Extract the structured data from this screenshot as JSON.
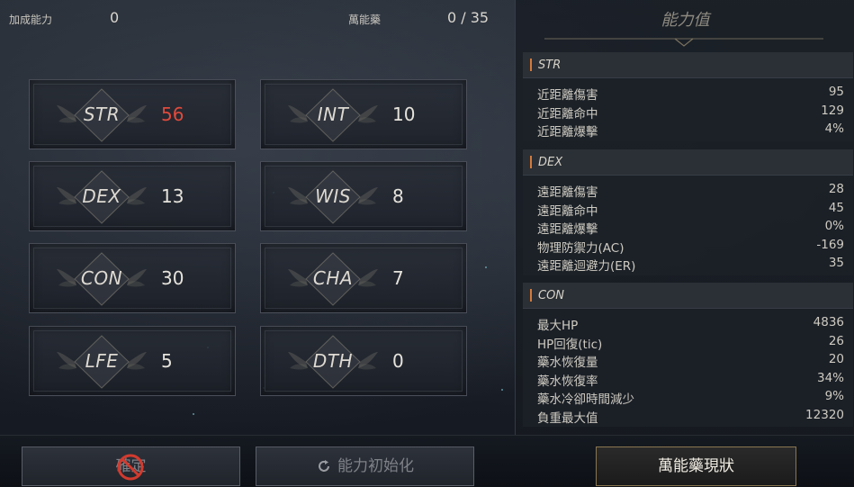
{
  "top": {
    "bonus_label": "加成能力",
    "bonus_value": "0",
    "elixir_label": "萬能藥",
    "elixir_value": "0 / 35"
  },
  "stats": [
    {
      "name": "STR",
      "value": "56",
      "highlight": true
    },
    {
      "name": "INT",
      "value": "10",
      "highlight": false
    },
    {
      "name": "DEX",
      "value": "13",
      "highlight": false
    },
    {
      "name": "WIS",
      "value": "8",
      "highlight": false
    },
    {
      "name": "CON",
      "value": "30",
      "highlight": false
    },
    {
      "name": "CHA",
      "value": "7",
      "highlight": false
    },
    {
      "name": "LFE",
      "value": "5",
      "highlight": false
    },
    {
      "name": "DTH",
      "value": "0",
      "highlight": false
    }
  ],
  "buttons": {
    "confirm_label": "確定",
    "reset_label": "能力初始化",
    "elixir_status_label": "萬能藥現狀"
  },
  "right_panel": {
    "title": "能力值",
    "sections": [
      {
        "header": "STR",
        "rows": [
          {
            "label": "近距離傷害",
            "value": "95"
          },
          {
            "label": "近距離命中",
            "value": "129"
          },
          {
            "label": "近距離爆擊",
            "value": "4%"
          }
        ]
      },
      {
        "header": "DEX",
        "rows": [
          {
            "label": "遠距離傷害",
            "value": "28"
          },
          {
            "label": "遠距離命中",
            "value": "45"
          },
          {
            "label": "遠距離爆擊",
            "value": "0%"
          },
          {
            "label": "物理防禦力(AC)",
            "value": "-169"
          },
          {
            "label": "遠距離迴避力(ER)",
            "value": "35"
          }
        ]
      },
      {
        "header": "CON",
        "rows": [
          {
            "label": "最大HP",
            "value": "4836"
          },
          {
            "label": "HP回復(tic)",
            "value": "26"
          },
          {
            "label": "藥水恢復量",
            "value": "20"
          },
          {
            "label": "藥水恢復率",
            "value": "34%"
          },
          {
            "label": "藥水冷卻時間減少",
            "value": "9%"
          },
          {
            "label": "負重最大值",
            "value": "12320"
          }
        ]
      }
    ]
  },
  "colors": {
    "accent_orange": "#d47a3a",
    "highlight_red": "#e04a3c",
    "gold_border": "#8a7650"
  },
  "icons": {
    "reset_icon": "refresh-icon",
    "confirm_disabled_icon": "prohibited-icon",
    "stat_emblem": "winged-diamond-emblem"
  }
}
